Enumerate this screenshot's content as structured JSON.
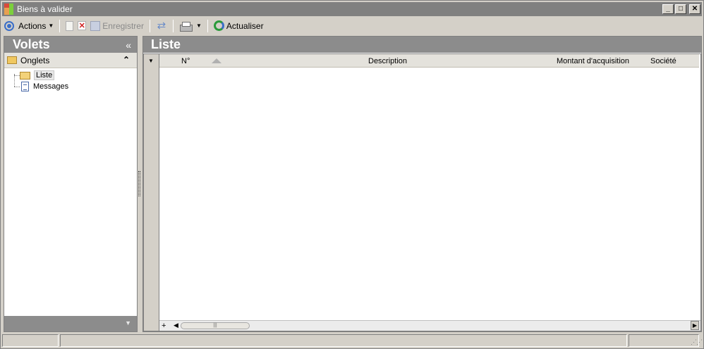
{
  "window": {
    "title": "Biens à valider"
  },
  "titlebar_buttons": {
    "minimize": "_",
    "maximize": "□",
    "close": "✕"
  },
  "toolbar": {
    "actions_label": "Actions",
    "save_label": "Enregistrer",
    "refresh_label": "Actualiser"
  },
  "left_panel": {
    "title": "Volets",
    "collapse_glyph": "«",
    "group": {
      "label": "Onglets",
      "toggle_glyph": "⌃"
    },
    "items": [
      {
        "label": "Liste"
      },
      {
        "label": "Messages"
      }
    ]
  },
  "right_panel": {
    "title": "Liste",
    "columns": {
      "number": "N°",
      "description": "Description",
      "amount": "Montant d'acquisition",
      "company": "Société"
    }
  },
  "colors": {
    "header_bg": "#8c8c8c",
    "titlebar_bg": "#808080",
    "window_bg": "#d4d0c8"
  }
}
